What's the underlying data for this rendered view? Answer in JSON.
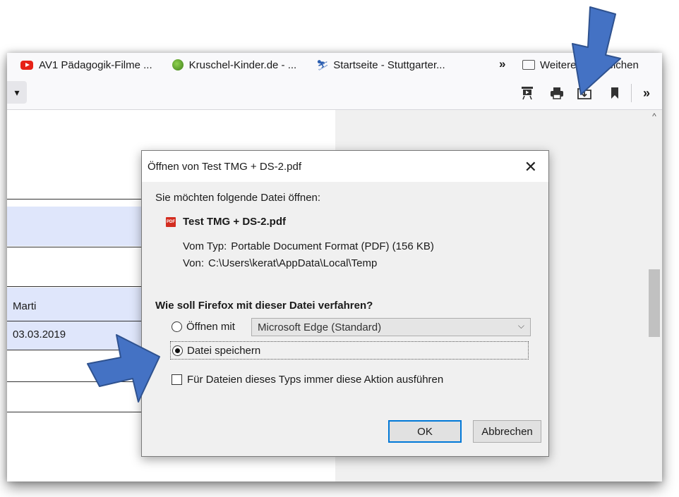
{
  "bookmarks": {
    "items": [
      {
        "label": "AV1 Pädagogik-Filme ...",
        "icon": "youtube-icon"
      },
      {
        "label": "Kruschel-Kinder.de - ...",
        "icon": "kruschel-icon"
      },
      {
        "label": "Startseite - Stuttgarter...",
        "icon": "stuttgart-icon"
      }
    ],
    "overflow_label": "»",
    "other_label": "Weitere Lesezeichen"
  },
  "toolbar": {
    "icons": [
      "presentation-icon",
      "print-icon",
      "save-icon",
      "bookmark-icon"
    ],
    "overflow_label": "»"
  },
  "document": {
    "name_value": "Marti",
    "date_value": "03.03.2019"
  },
  "dialog": {
    "title": "Öffnen von Test TMG + DS-2.pdf",
    "close_label": "✕",
    "prompt": "Sie möchten folgende Datei öffnen:",
    "file_name": "Test TMG + DS-2.pdf",
    "file_icon_text": "PDF",
    "type_label": "Vom Typ:",
    "type_value": "Portable Document Format (PDF) (156 KB)",
    "from_label": "Von:",
    "from_value": "C:\\Users\\kerat\\AppData\\Local\\Temp",
    "question": "Wie soll Firefox mit dieser Datei verfahren?",
    "open_with_label": "Öffnen mit",
    "open_with_value": "Microsoft Edge (Standard)",
    "save_label": "Datei speichern",
    "always_label": "Für Dateien dieses Typs immer diese Aktion ausführen",
    "ok_label": "OK",
    "cancel_label": "Abbrechen",
    "selected_action": "save",
    "always_checked": false
  },
  "colors": {
    "arrow": "#4472c4",
    "row_highlight": "#dfe6fb",
    "focus": "#0078d7"
  }
}
